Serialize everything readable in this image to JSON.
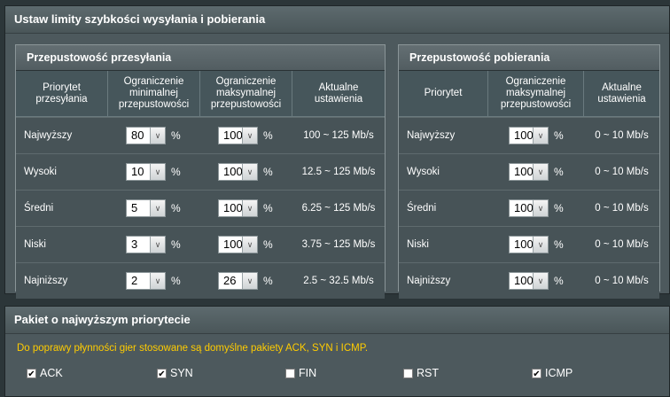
{
  "limits": {
    "title": "Ustaw limity szybkości wysyłania i pobierania",
    "upload": {
      "title": "Przepustowość przesyłania",
      "headers": [
        "Priorytet przesyłania",
        "Ograniczenie minimalnej przepustowości",
        "Ograniczenie maksymalnej przepustowości",
        "Aktualne ustawienia"
      ],
      "rows": [
        {
          "name": "Najwyższy",
          "min": "80",
          "max": "100",
          "current": "100 ~ 125 Mb/s"
        },
        {
          "name": "Wysoki",
          "min": "10",
          "max": "100",
          "current": "12.5 ~ 125 Mb/s"
        },
        {
          "name": "Średni",
          "min": "5",
          "max": "100",
          "current": "6.25 ~ 125 Mb/s"
        },
        {
          "name": "Niski",
          "min": "3",
          "max": "100",
          "current": "3.75 ~ 125 Mb/s"
        },
        {
          "name": "Najniższy",
          "min": "2",
          "max": "26",
          "current": "2.5 ~ 32.5 Mb/s"
        }
      ]
    },
    "download": {
      "title": "Przepustowość pobierania",
      "headers": [
        "Priorytet",
        "Ograniczenie maksymalnej przepustowości",
        "Aktualne ustawienia"
      ],
      "rows": [
        {
          "name": "Najwyższy",
          "max": "100",
          "current": "0 ~ 10 Mb/s"
        },
        {
          "name": "Wysoki",
          "max": "100",
          "current": "0 ~ 10 Mb/s"
        },
        {
          "name": "Średni",
          "max": "100",
          "current": "0 ~ 10 Mb/s"
        },
        {
          "name": "Niski",
          "max": "100",
          "current": "0 ~ 10 Mb/s"
        },
        {
          "name": "Najniższy",
          "max": "100",
          "current": "0 ~ 10 Mb/s"
        }
      ]
    },
    "percent": "%",
    "dropdown_icon": "chevron-down-icon"
  },
  "packets": {
    "title": "Pakiet o najwyższym priorytecie",
    "note": "Do poprawy płynności gier stosowane są domyślne pakiety ACK, SYN i ICMP.",
    "options": [
      {
        "label": "ACK",
        "checked": true
      },
      {
        "label": "SYN",
        "checked": true
      },
      {
        "label": "FIN",
        "checked": false
      },
      {
        "label": "RST",
        "checked": false
      },
      {
        "label": "ICMP",
        "checked": true
      }
    ]
  }
}
